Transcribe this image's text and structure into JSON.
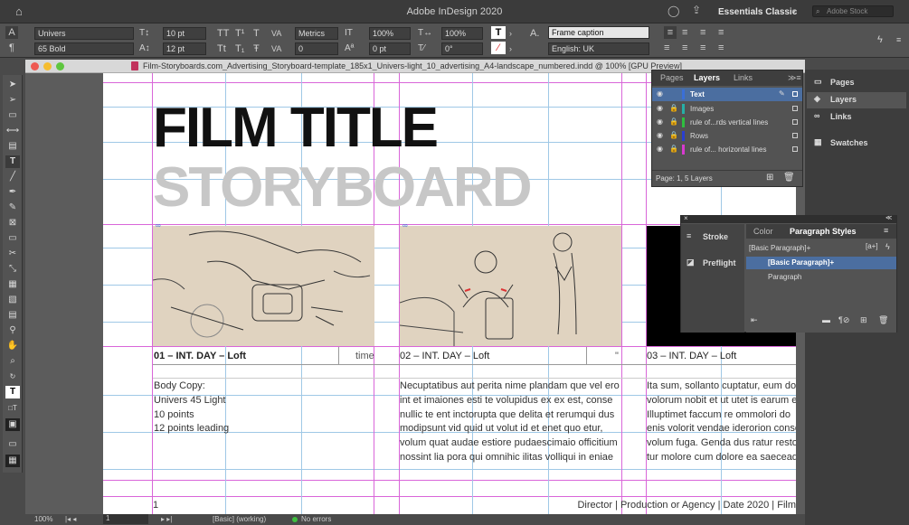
{
  "app": {
    "title": "Adobe InDesign 2020",
    "workspace": "Essentials Classic",
    "stock_placeholder": "Adobe Stock"
  },
  "control": {
    "font_family": "Univers",
    "font_style": "65 Bold",
    "font_size": "10 pt",
    "leading": "12 pt",
    "kerning": "Metrics",
    "tracking": "0",
    "v_scale": "100%",
    "h_scale": "100%",
    "baseline": "0 pt",
    "skew": "0°",
    "para_style": "Frame caption",
    "language": "English: UK"
  },
  "document": {
    "tab_title": "Film-Storyboards.com_Advertising_Storyboard-template_185x1_Univers-light_10_advertising_A4-landscape_numbered.indd @ 100% [GPU Preview]",
    "title": "FILM TITLE",
    "subtitle": "STORYBOARD",
    "captions": [
      "01 – INT. DAY – Loft",
      "02 – INT. DAY – Loft",
      "03 – INT. DAY – Loft"
    ],
    "time_label": "time",
    "time_mark": "\"",
    "body1": [
      "Body Copy:",
      "Univers 45 Light",
      "10 points",
      "12 points leading"
    ],
    "body2": [
      "Necuptatibus aut perita nime plandam que vel ero",
      "int et imaiones esti te volupidus ex ex est, conse",
      "nullic te ent inctorupta que delita et rerumqui dus",
      "modipsunt vid quid ut volut id et enet quo etur,",
      "volum quat audae estiore pudaescimaio officitium",
      "nossint lia pora qui omnihic ilitas volliqui in eniae"
    ],
    "body3": [
      "Ita sum, sollanto cuptatur, eum dol",
      "volorum nobit et ut utet is earum e",
      "Illuptimet faccum re ommolori do",
      "enis volorit vendae iderorion conse",
      "volum fuga. Genda dus ratur resto",
      "tur molore cum dolore ea saeceaqu"
    ],
    "page_number": "1",
    "footer": "Director  | Production or Agency | Date 2020 |  Film"
  },
  "status": {
    "zoom": "100%",
    "page": "1",
    "style": "[Basic] (working)",
    "errors": "No errors"
  },
  "layers_panel": {
    "tabs": [
      "Pages",
      "Layers",
      "Links"
    ],
    "layers": [
      {
        "name": "Text",
        "color": "#3a6fd8",
        "selected": true
      },
      {
        "name": "Images",
        "color": "#26b0a8",
        "selected": false
      },
      {
        "name": "rule of...rds vertical lines",
        "color": "#2fbf3f",
        "selected": false
      },
      {
        "name": "Rows",
        "color": "#2a3fd0",
        "selected": false
      },
      {
        "name": "rule of... horizontal lines",
        "color": "#d83ad0",
        "selected": false
      }
    ],
    "footer": "Page: 1, 5 Layers"
  },
  "dock": {
    "items": [
      "Pages",
      "Layers",
      "Links",
      "Swatches"
    ]
  },
  "mini_dock": {
    "items": [
      "Stroke",
      "Preflight"
    ]
  },
  "para_panel": {
    "tabs": [
      "Color",
      "Paragraph Styles"
    ],
    "current": "[Basic Paragraph]+",
    "styles": [
      "[Basic Paragraph]+",
      "Paragraph"
    ]
  },
  "colors": {
    "accent": "#4b6ea0",
    "frame_bg": "#e0d3c0",
    "guide_magenta": "#d966d9",
    "guide_blue": "#9fc8e6"
  }
}
